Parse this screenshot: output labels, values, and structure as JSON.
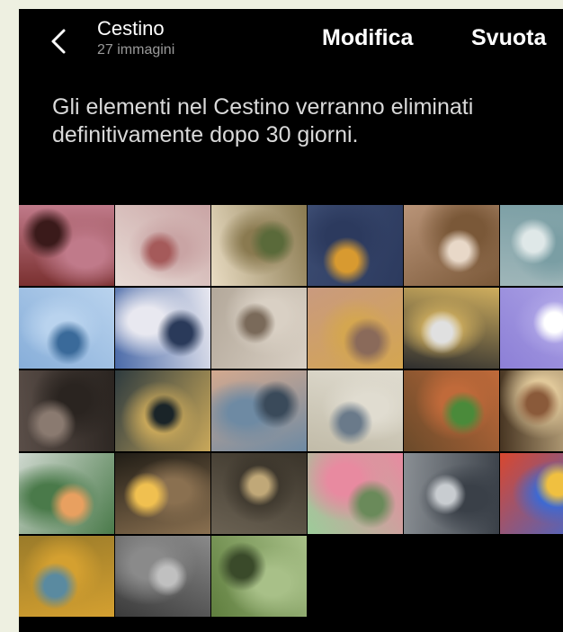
{
  "header": {
    "title": "Cestino",
    "subtitle": "27 immagini",
    "edit_label": "Modifica",
    "empty_label": "Svuota"
  },
  "notice": "Gli elementi nel Cestino verranno eliminati definitivamente dopo 30 giorni.",
  "icons": {
    "back": "chevron-left-icon"
  },
  "thumbnails": [
    {
      "name": "thumb-train-interior",
      "colors": [
        "#7a3030",
        "#c07a8a",
        "#3a1a1a"
      ]
    },
    {
      "name": "thumb-carousel",
      "colors": [
        "#e8dcd6",
        "#c9a4a4",
        "#a55a5a"
      ]
    },
    {
      "name": "thumb-plant-candles",
      "colors": [
        "#e9dcc3",
        "#8a7a50",
        "#5a6a3a"
      ]
    },
    {
      "name": "thumb-jeans-flowers",
      "colors": [
        "#3c4c72",
        "#2c3a5e",
        "#d89a30"
      ]
    },
    {
      "name": "thumb-cup-flowers",
      "colors": [
        "#b99478",
        "#7a5838",
        "#e8d8c8"
      ]
    },
    {
      "name": "thumb-vintage-car",
      "colors": [
        "#9fb6b9",
        "#7a9ea4",
        "#dfe8e8"
      ]
    },
    {
      "name": "thumb-blue-flowers",
      "colors": [
        "#87aed9",
        "#b9d3ee",
        "#3a6a9a"
      ]
    },
    {
      "name": "thumb-cameo-brooch",
      "colors": [
        "#4a6aa8",
        "#e8e8f0",
        "#2a3a5a"
      ]
    },
    {
      "name": "thumb-rings-table",
      "colors": [
        "#b3a89a",
        "#d9d0c4",
        "#7a6a5a"
      ]
    },
    {
      "name": "thumb-hand-rings",
      "colors": [
        "#c99a7f",
        "#d4a650",
        "#8a6a5a"
      ]
    },
    {
      "name": "thumb-watch-rings",
      "colors": [
        "#2e2e2e",
        "#cfae5e",
        "#e0e0e0"
      ]
    },
    {
      "name": "thumb-converse-shoe",
      "colors": [
        "#8c7fd6",
        "#b1a8e8",
        "#ffffff"
      ]
    },
    {
      "name": "thumb-road-dusk",
      "colors": [
        "#5a4e48",
        "#2a2420",
        "#8a7a70"
      ]
    },
    {
      "name": "thumb-street-night",
      "colors": [
        "#2e3b3f",
        "#c9a85a",
        "#1a2428"
      ]
    },
    {
      "name": "thumb-sea-sunset",
      "colors": [
        "#d3a98f",
        "#6e8aa3",
        "#3a4a5a"
      ]
    },
    {
      "name": "thumb-couple-hug",
      "colors": [
        "#c1bba8",
        "#e0dcd0",
        "#6a7a8a"
      ]
    },
    {
      "name": "thumb-food-table",
      "colors": [
        "#6a4a2a",
        "#c06a3a",
        "#4a8a3a"
      ]
    },
    {
      "name": "thumb-dinner-party",
      "colors": [
        "#473522",
        "#e0c89a",
        "#8a5a3a"
      ]
    },
    {
      "name": "thumb-laptop-sushi",
      "colors": [
        "#cfd8cf",
        "#4a7a4a",
        "#e8a060"
      ]
    },
    {
      "name": "thumb-night-scooter",
      "colors": [
        "#211d16",
        "#8a7050",
        "#f0c050"
      ]
    },
    {
      "name": "thumb-car-window",
      "colors": [
        "#6b6253",
        "#3a342a",
        "#c0a878"
      ]
    },
    {
      "name": "thumb-phone-rings",
      "colors": [
        "#9ccc9a",
        "#e88aa0",
        "#6a8a5a"
      ]
    },
    {
      "name": "thumb-skateboard-girl",
      "colors": [
        "#8a8f94",
        "#3a4048",
        "#c8ccd0"
      ]
    },
    {
      "name": "thumb-colorful-records",
      "colors": [
        "#d9472e",
        "#3a6ad6",
        "#f0c040"
      ]
    },
    {
      "name": "thumb-colorful-pattern",
      "colors": [
        "#9a7b2a",
        "#d4a030",
        "#5a8aa0"
      ]
    },
    {
      "name": "thumb-skateboards",
      "colors": [
        "#3a3a3a",
        "#8a8a8a",
        "#c0c0c0"
      ]
    },
    {
      "name": "thumb-greenhouse",
      "colors": [
        "#5f7e3e",
        "#a8c088",
        "#3a4a2a"
      ]
    }
  ]
}
